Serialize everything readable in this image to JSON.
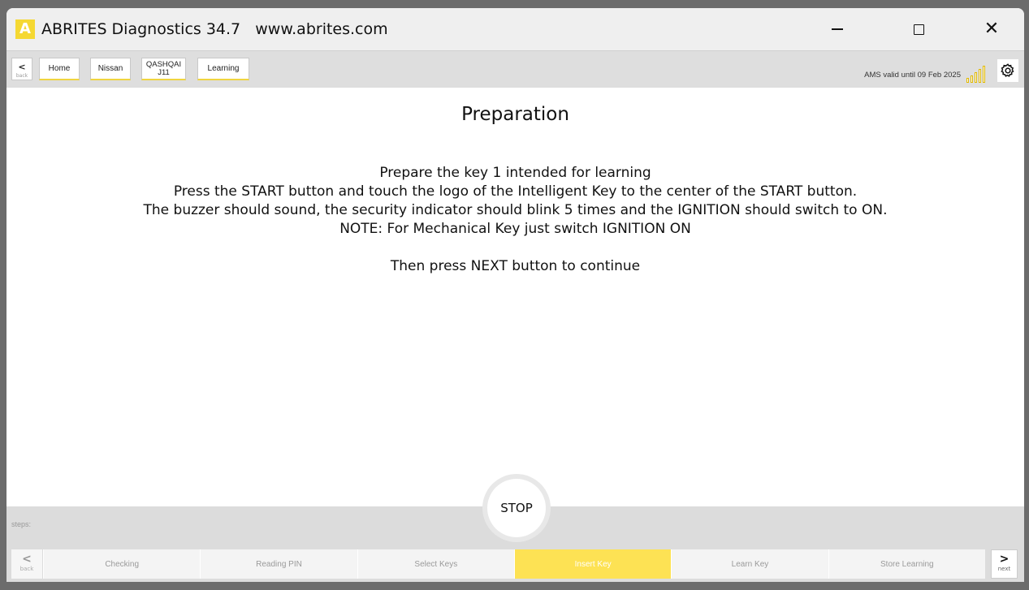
{
  "window": {
    "app_logo": "A",
    "title": "ABRITES Diagnostics 34.7   www.abrites.com"
  },
  "navbar": {
    "back_label": "back",
    "breadcrumbs": [
      {
        "label": "Home"
      },
      {
        "label": "Nissan"
      },
      {
        "line1": "QASHQAI",
        "line2": "J11"
      },
      {
        "label": "Learning"
      }
    ],
    "ams_status": "AMS valid until 09 Feb 2025"
  },
  "main": {
    "heading": "Preparation",
    "lines": [
      "Prepare the key 1 intended for learning",
      "Press the START button and touch the logo of the Intelligent Key to the center of the START button.",
      "The buzzer should sound, the security indicator should blink 5 times and the IGNITION should switch to ON.",
      "NOTE: For Mechanical Key just switch IGNITION ON",
      "Then press NEXT button to continue"
    ],
    "stop_label": "STOP"
  },
  "steps": {
    "label": "steps:",
    "back_label": "back",
    "next_label": "next",
    "items": [
      "Checking",
      "Reading PIN",
      "Select Keys",
      "Insert Key",
      "Learn Key",
      "Store Learning"
    ],
    "active_index": 3
  },
  "colors": {
    "accent": "#fde254",
    "logo": "#f5d832",
    "signal": "#e0b800"
  }
}
